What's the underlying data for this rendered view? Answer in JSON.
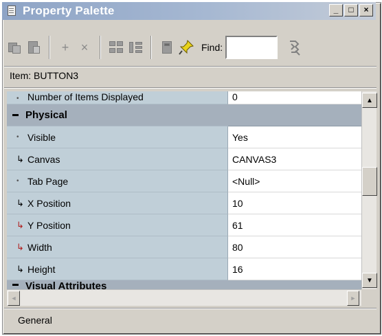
{
  "window": {
    "title": "Property Palette",
    "controls": {
      "minimize": "_",
      "maximize": "□",
      "close": "×"
    }
  },
  "toolbar": {
    "icons": [
      "copy-properties-icon",
      "paste-properties-icon",
      "add-property-icon",
      "delete-property-icon",
      "union-icon",
      "intersection-icon",
      "freeze-icon",
      "pin-icon",
      "find-next-icon"
    ],
    "add_glyph": "+",
    "delete_glyph": "×",
    "find_label": "Find:",
    "find_value": ""
  },
  "item": {
    "label": "Item: BUTTON3"
  },
  "properties": {
    "top_partial": {
      "name": "Number of Items Displayed",
      "value": "0"
    },
    "section": "Physical",
    "rows": [
      {
        "name": "Visible",
        "value": "Yes",
        "marker": "dot"
      },
      {
        "name": "Canvas",
        "value": "CANVAS3",
        "marker": "inherit"
      },
      {
        "name": "Tab Page",
        "value": "<Null>",
        "marker": "dot"
      },
      {
        "name": "X Position",
        "value": "10",
        "marker": "inherit"
      },
      {
        "name": "Y Position",
        "value": "61",
        "marker": "changed"
      },
      {
        "name": "Width",
        "value": "80",
        "marker": "changed"
      },
      {
        "name": "Height",
        "value": "16",
        "marker": "inherit"
      }
    ],
    "next_section_partial": "Visual Attributes"
  },
  "scrollbar": {
    "up": "▲",
    "down": "▼",
    "left": "◄",
    "right": "►"
  },
  "status": {
    "text": "General"
  }
}
